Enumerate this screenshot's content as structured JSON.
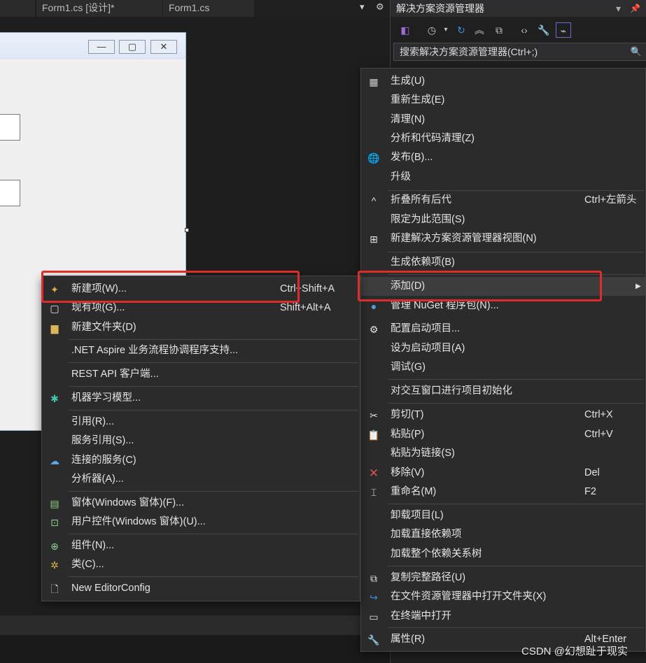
{
  "tabs": [
    {
      "label": ""
    },
    {
      "label": "Form1.cs [设计]*"
    },
    {
      "label": "Form1.cs"
    }
  ],
  "tab_controls": {
    "dropdown": "▾",
    "settings": "⚙"
  },
  "form_window": {
    "minimize": "—",
    "maximize": "▢",
    "close": "✕"
  },
  "solution_explorer": {
    "title": "解决方案资源管理器",
    "pin": "📌",
    "search_placeholder": "搜索解决方案资源管理器(Ctrl+;)",
    "search_icon": "🔍"
  },
  "main_menu": {
    "items": [
      {
        "label": "生成(U)",
        "shortcut": "",
        "icon": "build-icon"
      },
      {
        "label": "重新生成(E)",
        "shortcut": ""
      },
      {
        "label": "清理(N)",
        "shortcut": ""
      },
      {
        "label": "分析和代码清理(Z)",
        "shortcut": ""
      },
      {
        "label": "发布(B)...",
        "shortcut": "",
        "icon": "publish-globe-icon"
      },
      {
        "label": "升级",
        "shortcut": ""
      },
      {
        "label": "折叠所有后代",
        "shortcut": "Ctrl+左箭头",
        "icon": "chevron-up-icon"
      },
      {
        "label": "限定为此范围(S)",
        "shortcut": ""
      },
      {
        "label": "新建解决方案资源管理器视图(N)",
        "shortcut": "",
        "icon": "new-view-icon"
      },
      {
        "label": "生成依赖项(B)",
        "shortcut": ""
      },
      {
        "label": "添加(D)",
        "shortcut": ""
      },
      {
        "label": "管理 NuGet 程序包(N)...",
        "shortcut": "",
        "icon": "nuget-icon"
      },
      {
        "label": "配置启动项目...",
        "shortcut": "",
        "icon": "gear-icon"
      },
      {
        "label": "设为启动项目(A)",
        "shortcut": ""
      },
      {
        "label": "调试(G)",
        "shortcut": ""
      },
      {
        "label": "对交互窗口进行项目初始化",
        "shortcut": ""
      },
      {
        "label": "剪切(T)",
        "shortcut": "Ctrl+X",
        "icon": "scissors-icon"
      },
      {
        "label": "粘贴(P)",
        "shortcut": "Ctrl+V",
        "icon": "paste-icon"
      },
      {
        "label": "粘贴为链接(S)",
        "shortcut": ""
      },
      {
        "label": "移除(V)",
        "shortcut": "Del",
        "icon": "remove-x-icon"
      },
      {
        "label": "重命名(M)",
        "shortcut": "F2",
        "icon": "rename-icon"
      },
      {
        "label": "卸载项目(L)",
        "shortcut": ""
      },
      {
        "label": "加载直接依赖项",
        "shortcut": ""
      },
      {
        "label": "加载整个依赖关系树",
        "shortcut": ""
      },
      {
        "label": "复制完整路径(U)",
        "shortcut": "",
        "icon": "copy-icon"
      },
      {
        "label": "在文件资源管理器中打开文件夹(X)",
        "shortcut": "",
        "icon": "refresh-arrow-icon"
      },
      {
        "label": "在终端中打开",
        "shortcut": "",
        "icon": "terminal-icon"
      },
      {
        "label": "属性(R)",
        "shortcut": "Alt+Enter",
        "icon": "wrench-icon"
      }
    ]
  },
  "sub_menu": {
    "items": [
      {
        "label": "新建项(W)...",
        "shortcut": "Ctrl+Shift+A",
        "icon": "new-item-icon"
      },
      {
        "label": "现有项(G)...",
        "shortcut": "Shift+Alt+A",
        "icon": "existing-item-icon"
      },
      {
        "label": "新建文件夹(D)",
        "shortcut": "",
        "icon": "folder-icon"
      },
      {
        "label": ".NET Aspire 业务流程协调程序支持...",
        "shortcut": ""
      },
      {
        "label": "REST API 客户端...",
        "shortcut": ""
      },
      {
        "label": "机器学习模型...",
        "shortcut": "",
        "icon": "ml-model-icon"
      },
      {
        "label": "引用(R)...",
        "shortcut": ""
      },
      {
        "label": "服务引用(S)...",
        "shortcut": ""
      },
      {
        "label": "连接的服务(C)",
        "shortcut": "",
        "icon": "connected-service-icon"
      },
      {
        "label": "分析器(A)...",
        "shortcut": ""
      },
      {
        "label": "窗体(Windows 窗体)(F)...",
        "shortcut": "",
        "icon": "form-icon"
      },
      {
        "label": "用户控件(Windows 窗体)(U)...",
        "shortcut": "",
        "icon": "user-control-icon"
      },
      {
        "label": "组件(N)...",
        "shortcut": "",
        "icon": "component-icon"
      },
      {
        "label": "类(C)...",
        "shortcut": "",
        "icon": "class-icon"
      },
      {
        "label": "New EditorConfig",
        "shortcut": "",
        "icon": "file-icon"
      }
    ]
  },
  "watermark": "CSDN @幻想趾于现实",
  "colors": {
    "highlight_box": "#e02b2b",
    "menu_bg": "#2b2b2b",
    "menu_hover": "#3d3d3d"
  }
}
